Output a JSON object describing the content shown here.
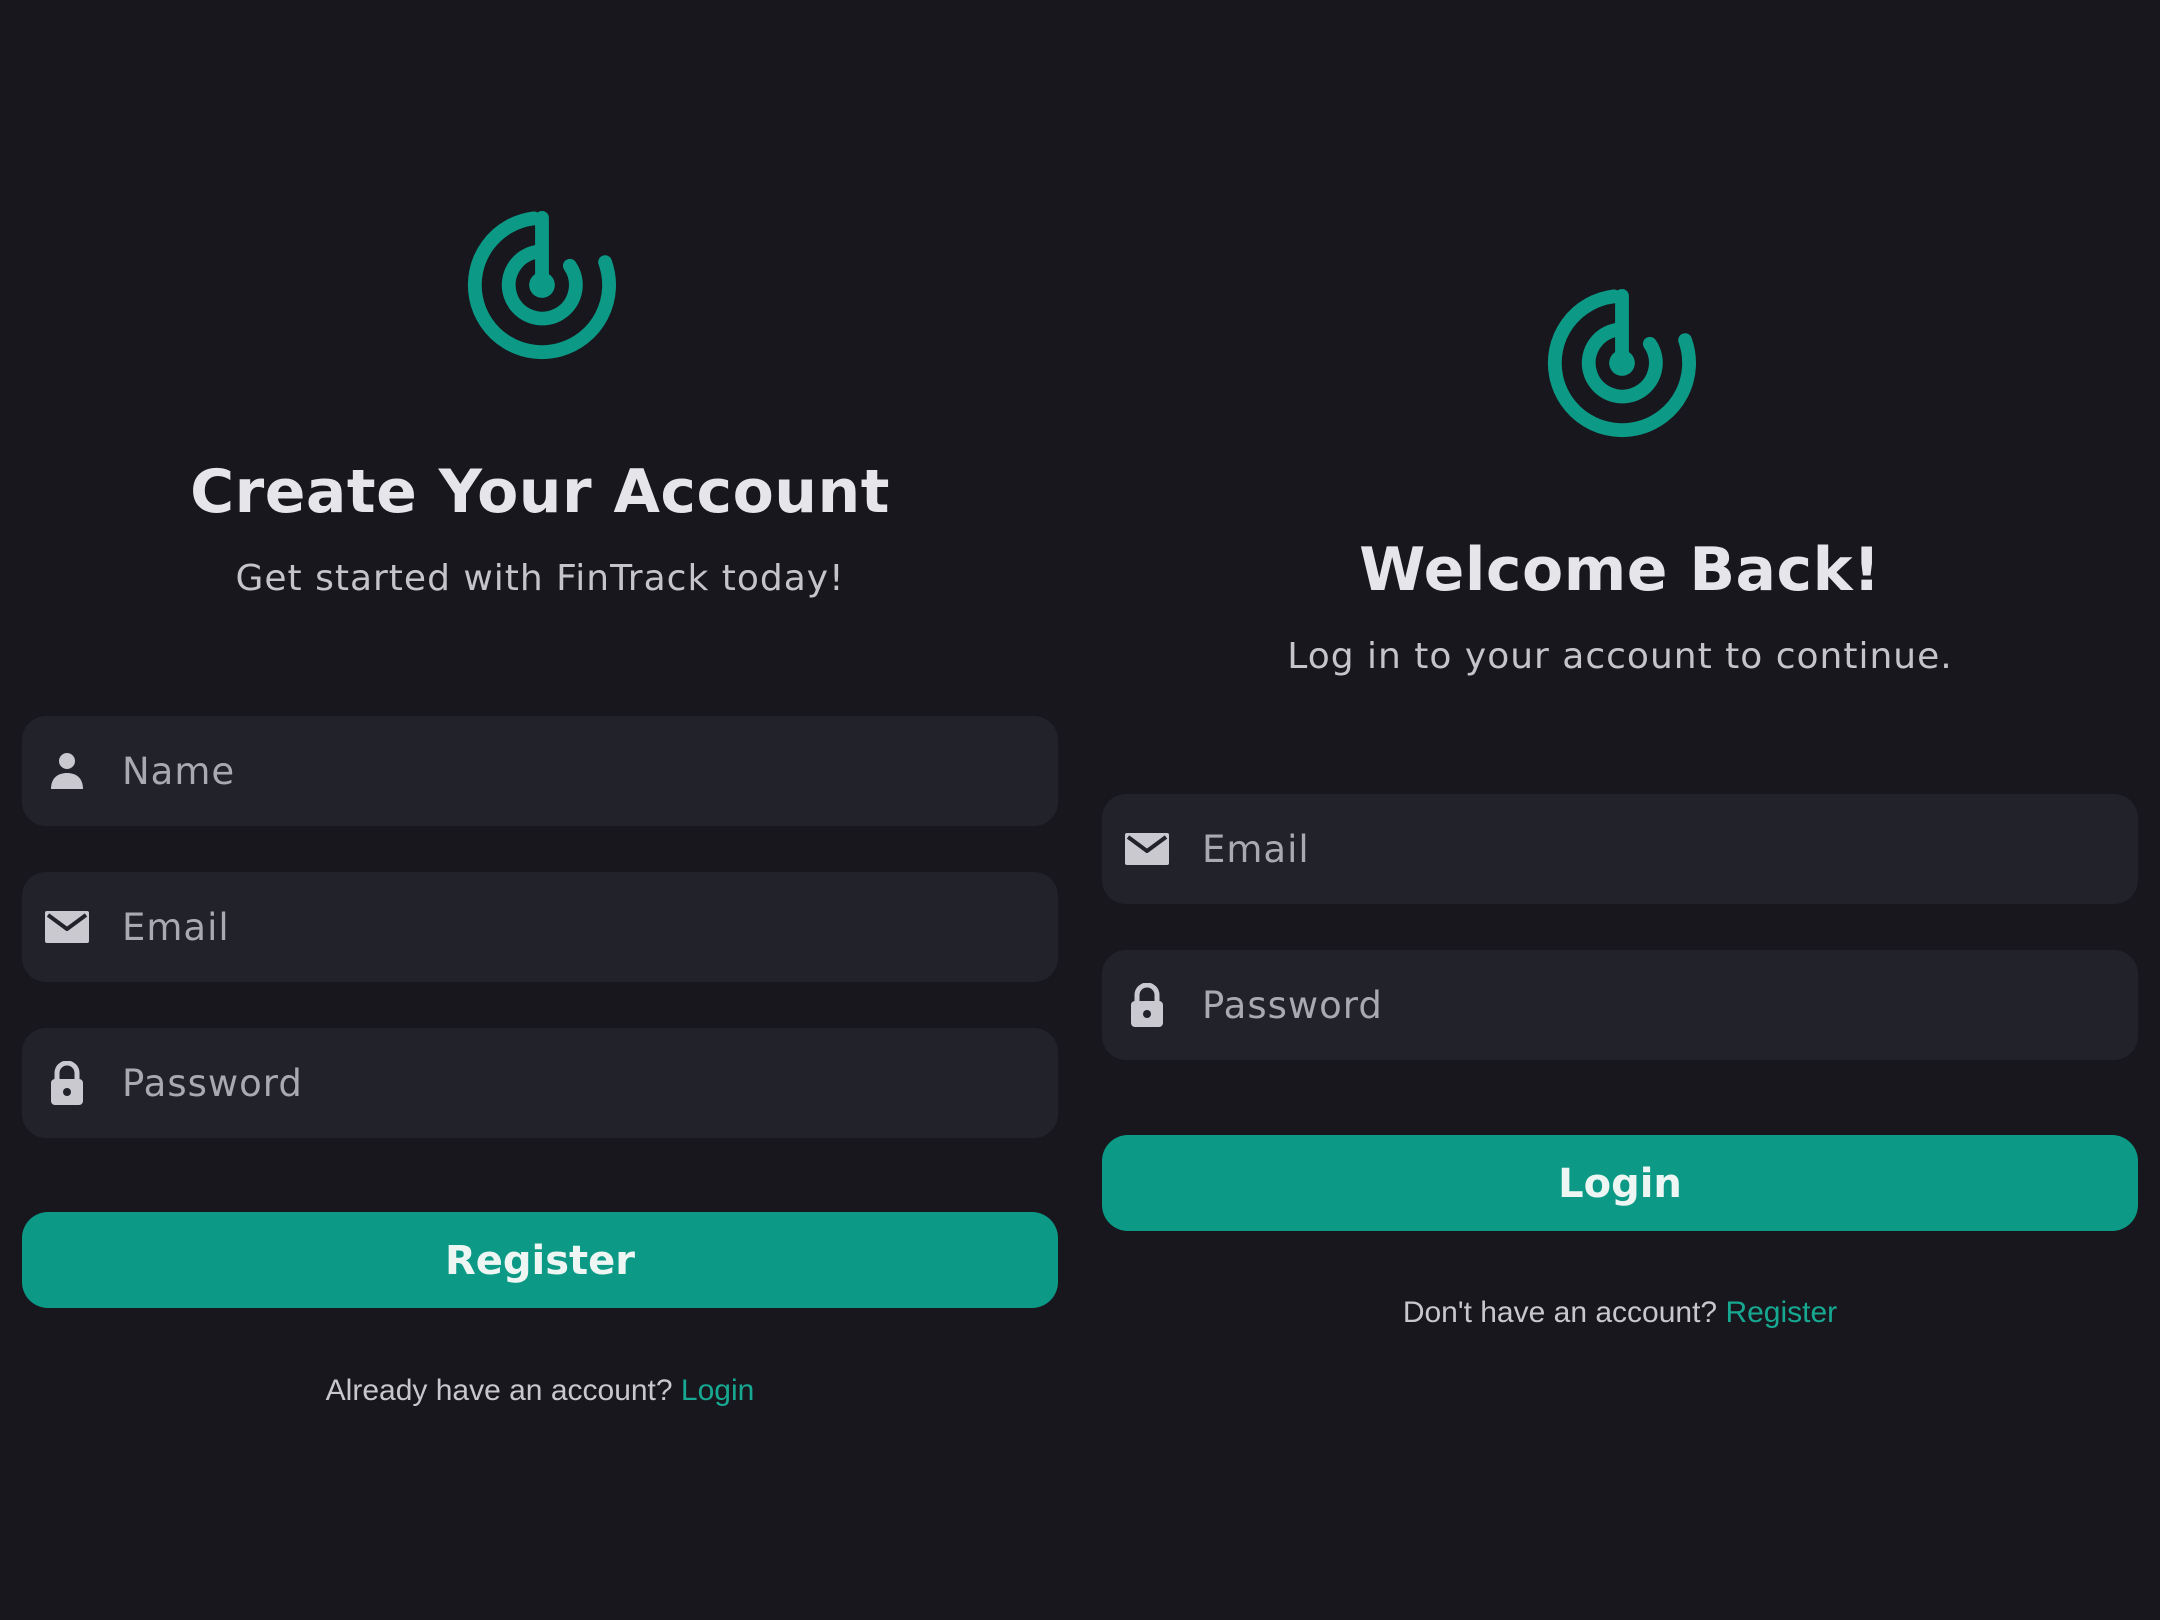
{
  "colors": {
    "background": "#17171d",
    "field_background": "#22222b",
    "accent": "#0c9a86",
    "link": "#17a892",
    "title_text": "#e6e6ea",
    "subtitle_text": "#c4c4ca"
  },
  "register": {
    "logo_icon": "target-spiral-logo-icon",
    "title": "Create Your Account",
    "subtitle": "Get started with FinTrack today!",
    "fields": [
      {
        "icon": "person-icon",
        "placeholder": "Name",
        "value": ""
      },
      {
        "icon": "mail-icon",
        "placeholder": "Email",
        "value": ""
      },
      {
        "icon": "lock-icon",
        "placeholder": "Password",
        "value": ""
      }
    ],
    "button_label": "Register",
    "footer_text": "Already have an account?",
    "footer_link": "Login"
  },
  "login": {
    "logo_icon": "target-spiral-logo-icon",
    "title": "Welcome Back!",
    "subtitle": "Log in to your account to continue.",
    "fields": [
      {
        "icon": "mail-icon",
        "placeholder": "Email",
        "value": ""
      },
      {
        "icon": "lock-icon",
        "placeholder": "Password",
        "value": ""
      }
    ],
    "button_label": "Login",
    "footer_text": "Don't have an account?",
    "footer_link": "Register"
  }
}
